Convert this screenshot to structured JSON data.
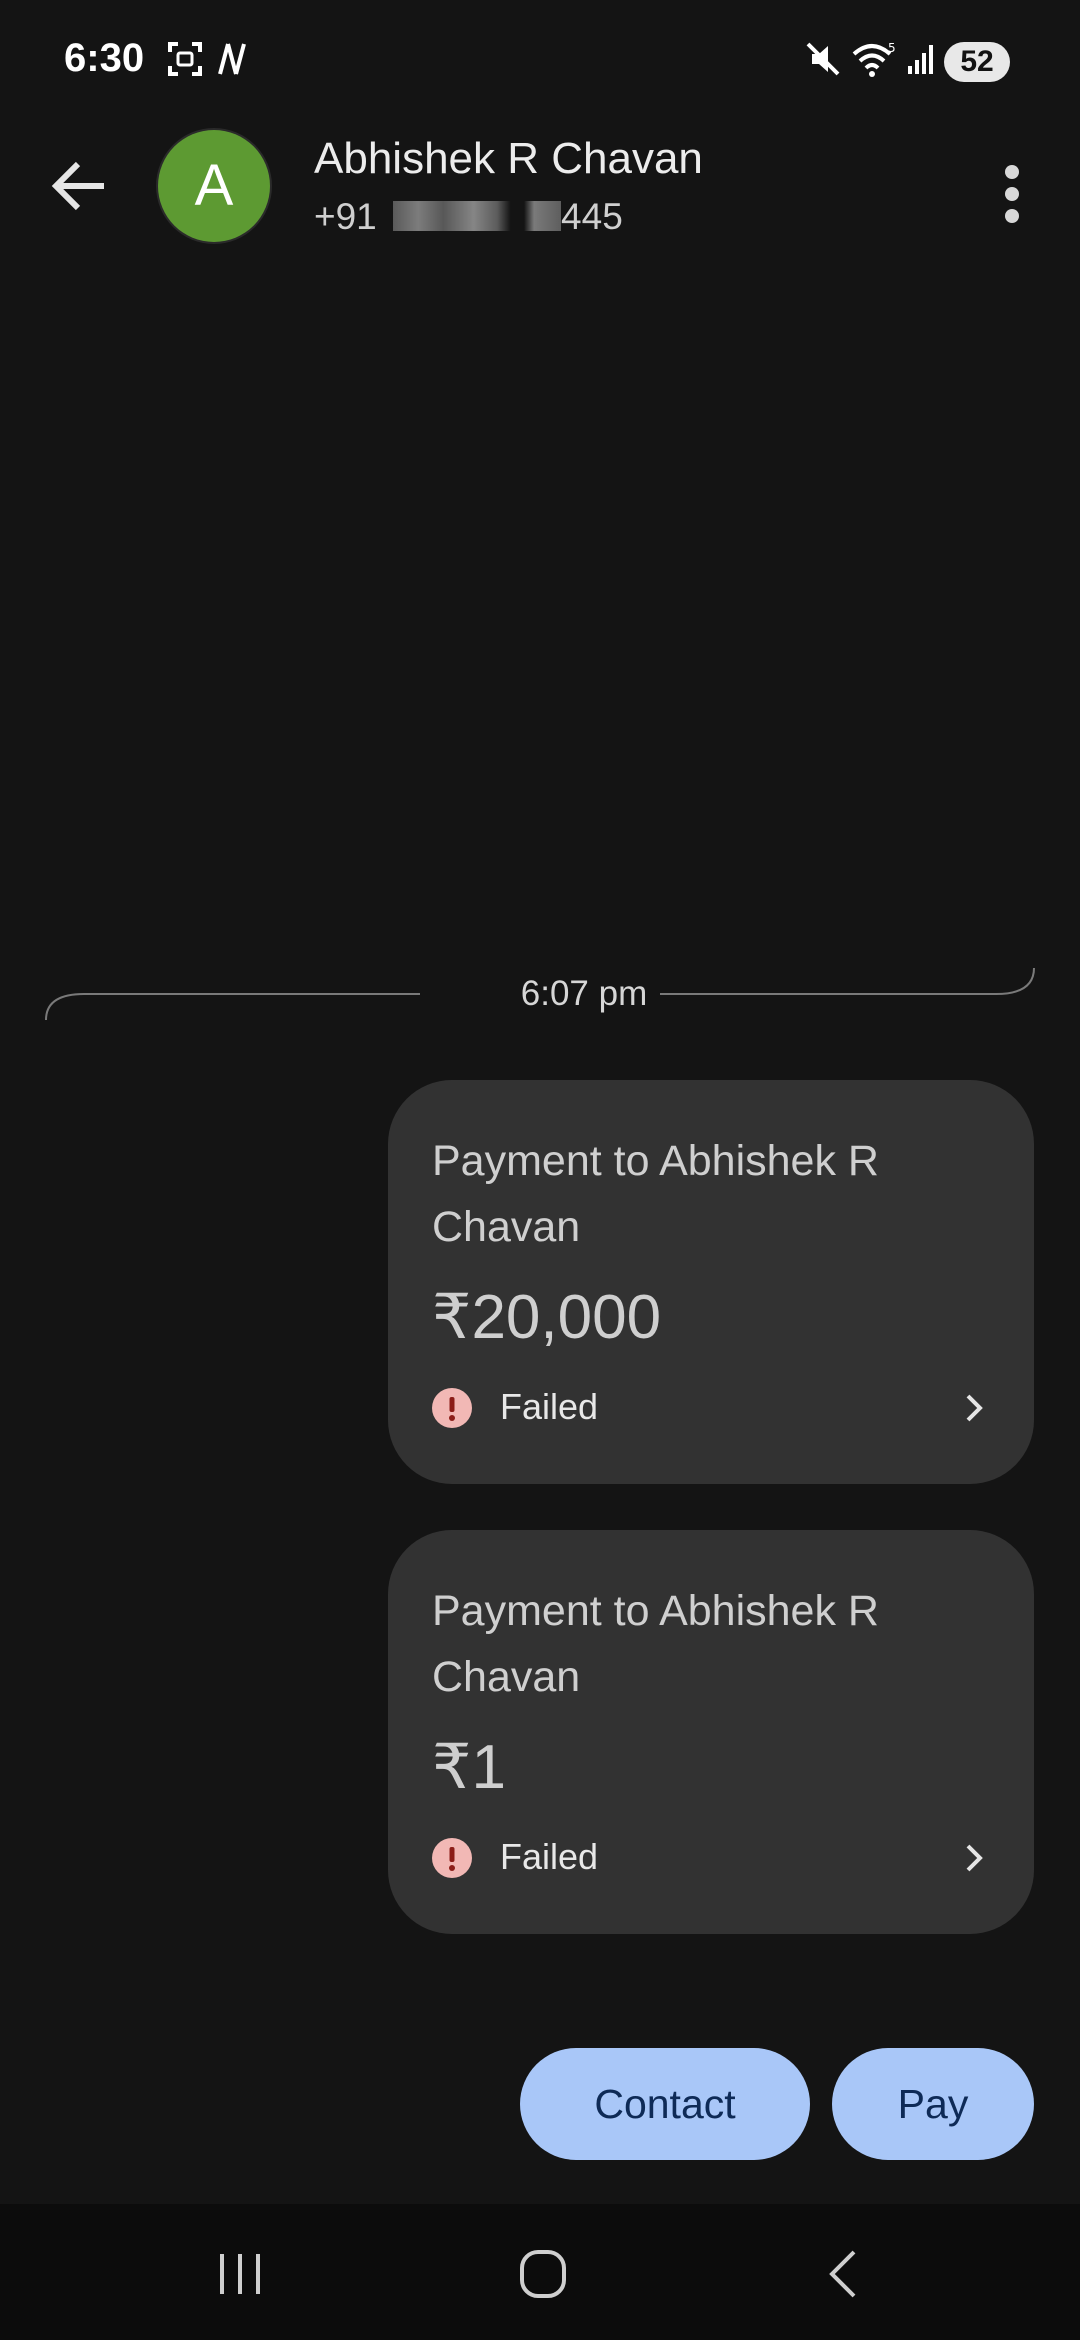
{
  "status_bar": {
    "time": "6:30",
    "battery": "52",
    "icons": [
      "screenshot-icon",
      "nfc-icon",
      "mute-icon",
      "wifi-icon",
      "signal-icon"
    ]
  },
  "header": {
    "back_icon": "back-arrow-icon",
    "avatar_initial": "A",
    "avatar_color": "#5d9a32",
    "name": "Abhishek R Chavan",
    "number_prefix": "+91",
    "number_suffix": "445",
    "more_icon": "more-vert-icon"
  },
  "conversation": {
    "timestamp": "6:07 pm",
    "payments": [
      {
        "title": "Payment to Abhishek R Chavan",
        "amount": "₹20,000",
        "status": "Failed"
      },
      {
        "title": "Payment to Abhishek R Chavan",
        "amount": "₹1",
        "status": "Failed"
      }
    ]
  },
  "actions": {
    "contact_label": "Contact",
    "pay_label": "Pay",
    "button_color": "#a9c7f8"
  },
  "navbar": {
    "recents_icon": "recents-icon",
    "home_icon": "home-icon",
    "back_icon": "nav-back-icon"
  },
  "colors": {
    "background": "#141414",
    "card": "#323232",
    "failed": "#f2b8b5"
  }
}
